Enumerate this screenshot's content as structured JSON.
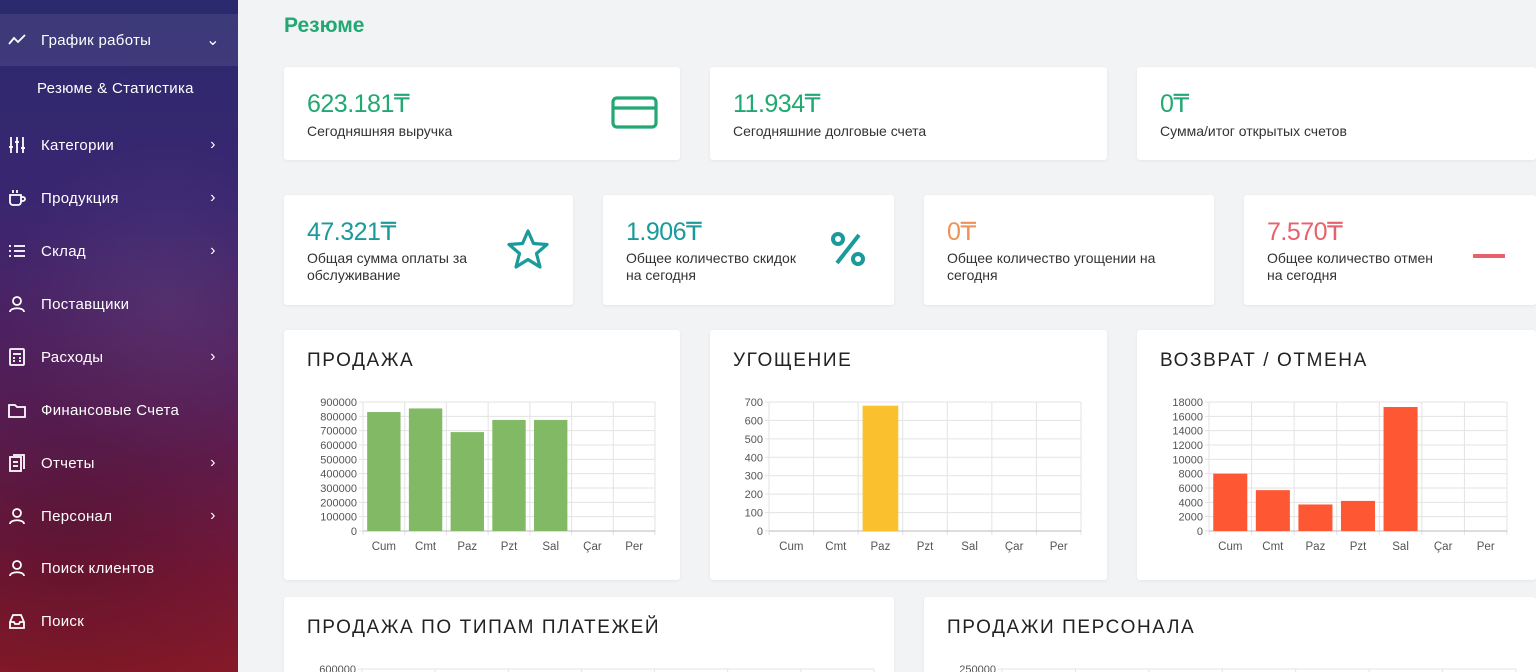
{
  "sidebar": {
    "items": [
      {
        "label": "График работы",
        "icon": "trend-line-icon",
        "chevron": "⌄",
        "active": true
      },
      {
        "label": "Категории",
        "icon": "sliders-icon",
        "chevron": "›"
      },
      {
        "label": "Продукция",
        "icon": "cup-icon",
        "chevron": "›"
      },
      {
        "label": "Склад",
        "icon": "list-icon",
        "chevron": "›"
      },
      {
        "label": "Поставщики",
        "icon": "user-icon",
        "chevron": ""
      },
      {
        "label": "Расходы",
        "icon": "calculator-icon",
        "chevron": "›"
      },
      {
        "label": "Финансовые Счета",
        "icon": "folder-icon",
        "chevron": ""
      },
      {
        "label": "Отчеты",
        "icon": "report-icon",
        "chevron": "›"
      },
      {
        "label": "Персонал",
        "icon": "user-icon",
        "chevron": "›"
      },
      {
        "label": "Поиск клиентов",
        "icon": "user-icon",
        "chevron": ""
      },
      {
        "label": "Поиск",
        "icon": "inbox-icon",
        "chevron": ""
      }
    ],
    "subitem": "Резюме & Статистика"
  },
  "page": {
    "title": "Резюме"
  },
  "stats_top": [
    {
      "value": "623.181₸",
      "label": "Сегодняшняя выручка",
      "color": "#22a872",
      "icon": "credit-card-icon"
    },
    {
      "value": "11.934₸",
      "label": "Сегодняшние долговые счета",
      "color": "#22a872",
      "icon": ""
    },
    {
      "value": "0₸",
      "label": "Сумма/итог открытых счетов",
      "color": "#22a872",
      "icon": ""
    }
  ],
  "stats_bottom": [
    {
      "value": "47.321₸",
      "label1": "Общая сумма оплаты за",
      "label2": "обслуживание",
      "color": "#1a9a9a",
      "icon": "star-icon"
    },
    {
      "value": "1.906₸",
      "label1": "Общее количество скидок",
      "label2": "на сегодня",
      "color": "#1a9a9a",
      "icon": "percent-icon"
    },
    {
      "value": "0₸",
      "label1": "Общее количество угощении на",
      "label2": "сегодня",
      "color": "#f0925a",
      "icon": ""
    },
    {
      "value": "7.570₸",
      "label1": "Общее количество отмен",
      "label2": "на сегодня",
      "color": "#e8606a",
      "icon": "minus-icon"
    }
  ],
  "chart_titles": {
    "sales": "ПРОДАЖА",
    "treat": "УГОЩЕНИЕ",
    "refund": "ВОЗВРАТ / ОТМЕНА",
    "payment": "ПРОДАЖА ПО ТИПАМ ПЛАТЕЖЕЙ",
    "staff": "ПРОДАЖИ ПЕРСОНАЛА"
  },
  "chart_data": [
    {
      "type": "bar",
      "title": "ПРОДАЖА",
      "categories": [
        "Cum",
        "Cmt",
        "Paz",
        "Pzt",
        "Sal",
        "Çar",
        "Per"
      ],
      "values": [
        830000,
        855000,
        690000,
        775000,
        775000,
        0,
        0
      ],
      "ylim": [
        0,
        900000
      ],
      "yticks": [
        0,
        100000,
        200000,
        300000,
        400000,
        500000,
        600000,
        700000,
        800000,
        900000
      ],
      "color": "#82b965",
      "grid": true
    },
    {
      "type": "bar",
      "title": "УГОЩЕНИЕ",
      "categories": [
        "Cum",
        "Cmt",
        "Paz",
        "Pzt",
        "Sal",
        "Çar",
        "Per"
      ],
      "values": [
        0,
        0,
        680,
        0,
        0,
        0,
        0
      ],
      "ylim": [
        0,
        700
      ],
      "yticks": [
        0,
        100,
        200,
        300,
        400,
        500,
        600,
        700
      ],
      "color": "#fbc02d",
      "grid": true
    },
    {
      "type": "bar",
      "title": "ВОЗВРАТ / ОТМЕНА",
      "categories": [
        "Cum",
        "Cmt",
        "Paz",
        "Pzt",
        "Sal",
        "Çar",
        "Per"
      ],
      "values": [
        8000,
        5700,
        3700,
        4200,
        17300,
        0,
        0
      ],
      "ylim": [
        0,
        18000
      ],
      "yticks": [
        0,
        2000,
        4000,
        6000,
        8000,
        10000,
        12000,
        14000,
        16000,
        18000
      ],
      "color": "#fe5733",
      "grid": true
    },
    {
      "type": "bar",
      "title": "ПРОДАЖА ПО ТИПАМ ПЛАТЕЖЕЙ",
      "yticks_visible": [
        "600000"
      ]
    },
    {
      "type": "bar",
      "title": "ПРОДАЖИ ПЕРСОНАЛА",
      "yticks_visible": [
        "250000"
      ]
    }
  ]
}
